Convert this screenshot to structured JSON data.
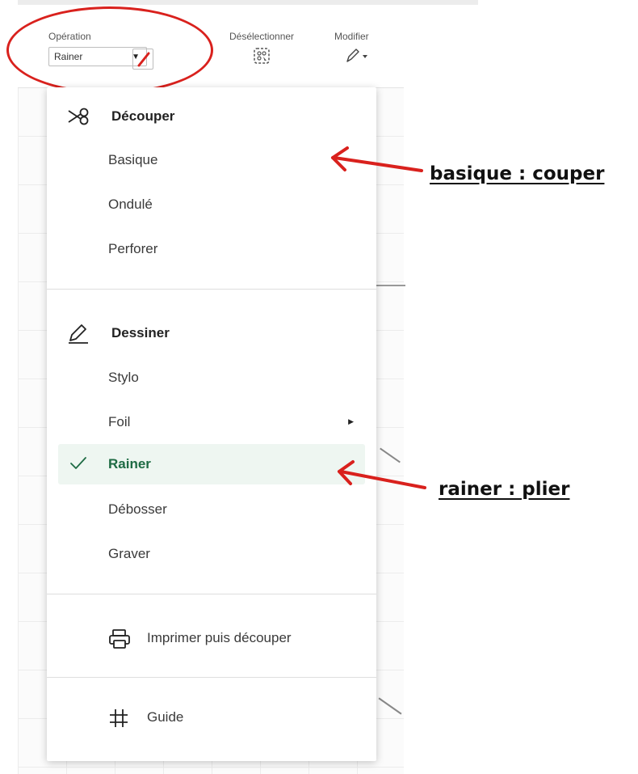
{
  "toolbar": {
    "operation_label": "Opération",
    "operation_value": "Rainer",
    "deselect_label": "Désélectionner",
    "modify_label": "Modifier",
    "pen_color": "#d9211d"
  },
  "menu": {
    "cut_header": "Découper",
    "cut_items": [
      "Basique",
      "Ondulé",
      "Perforer"
    ],
    "draw_header": "Dessiner",
    "draw_items": [
      "Stylo",
      "Foil"
    ],
    "selected_item": "Rainer",
    "after_selected_items": [
      "Débosser",
      "Graver"
    ],
    "print_then_cut": "Imprimer puis découper",
    "guide": "Guide"
  },
  "annotations": {
    "basique": "basique : couper",
    "rainer": "rainer : plier",
    "color": "#d9211d"
  },
  "icons": {
    "cut": "scissors-icon",
    "draw": "pencil-icon",
    "check": "check-icon",
    "print": "printer-icon",
    "guide": "guide-icon"
  }
}
